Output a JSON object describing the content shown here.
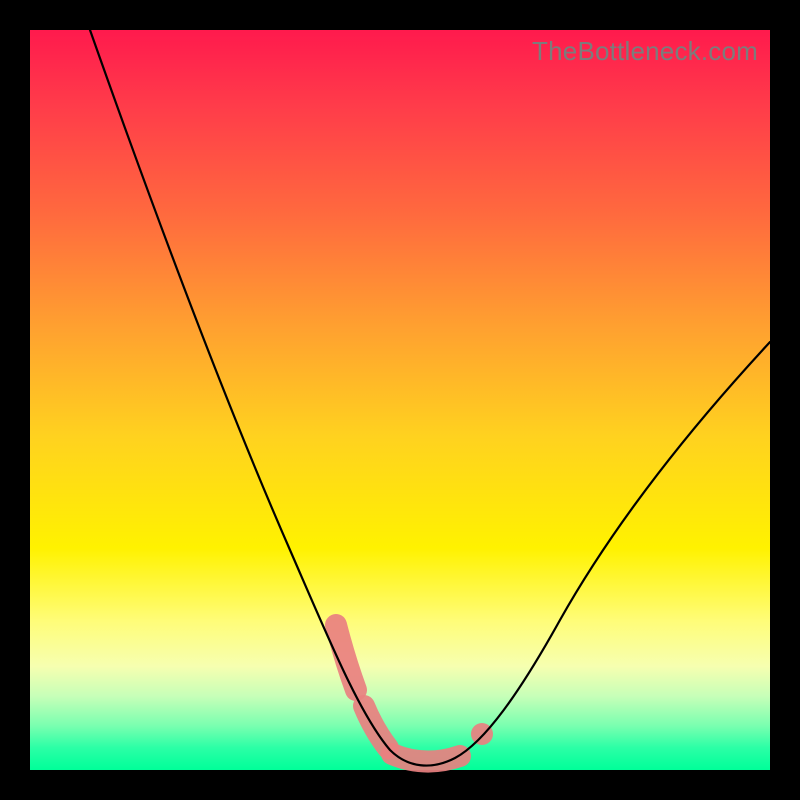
{
  "watermark": "TheBottleneck.com",
  "colors": {
    "frame": "#000000",
    "curve": "#000000",
    "highlight": "#e98080",
    "gradient_top": "#ff1a4d",
    "gradient_bottom": "#00ff99"
  },
  "chart_data": {
    "type": "line",
    "title": "",
    "xlabel": "",
    "ylabel": "",
    "xlim": [
      0,
      100
    ],
    "ylim": [
      0,
      100
    ],
    "legend": false,
    "grid": false,
    "series": [
      {
        "name": "bottleneck-curve",
        "x": [
          8,
          12,
          16,
          20,
          24,
          28,
          32,
          36,
          40,
          44,
          46,
          48,
          50,
          52,
          54,
          56,
          58,
          62,
          66,
          70,
          74,
          78,
          82,
          86,
          90,
          94,
          98,
          100
        ],
        "values": [
          100,
          92,
          84,
          76,
          68,
          60,
          52,
          44,
          36,
          22,
          15,
          8,
          3,
          1,
          1,
          2,
          5,
          12,
          20,
          27,
          33,
          38,
          43,
          47,
          51,
          54,
          57,
          58
        ]
      }
    ],
    "annotations": [
      {
        "type": "highlight-segment",
        "x_start": 44,
        "x_end": 60,
        "note": "salmon thick range near minimum"
      }
    ]
  }
}
